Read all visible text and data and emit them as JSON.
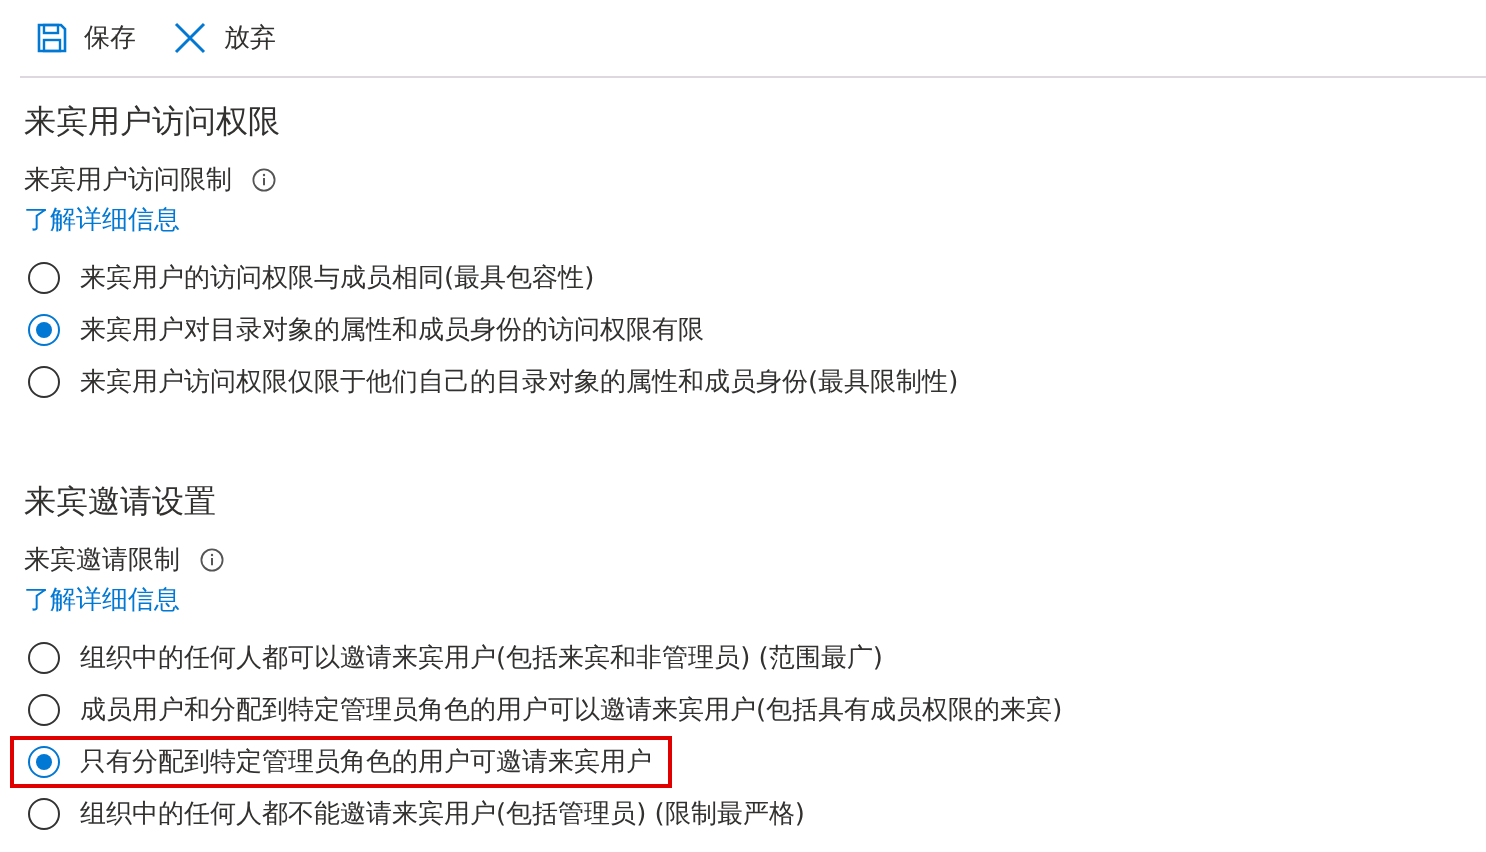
{
  "toolbar": {
    "buttons": [
      {
        "kind": "save",
        "label": "保存"
      },
      {
        "kind": "discard",
        "label": "放弃"
      }
    ]
  },
  "sections": [
    {
      "title": "来宾用户访问权限",
      "field_label": "来宾用户访问限制",
      "link": "了解详细信息",
      "options": [
        {
          "label": "来宾用户的访问权限与成员相同(最具包容性)",
          "selected": false,
          "highlighted": false
        },
        {
          "label": "来宾用户对目录对象的属性和成员身份的访问权限有限",
          "selected": true,
          "highlighted": false
        },
        {
          "label": "来宾用户访问权限仅限于他们自己的目录对象的属性和成员身份(最具限制性)",
          "selected": false,
          "highlighted": false
        }
      ]
    },
    {
      "title": "来宾邀请设置",
      "field_label": "来宾邀请限制",
      "link": "了解详细信息",
      "options": [
        {
          "label": "组织中的任何人都可以邀请来宾用户(包括来宾和非管理员) (范围最广)",
          "selected": false,
          "highlighted": false
        },
        {
          "label": "成员用户和分配到特定管理员角色的用户可以邀请来宾用户(包括具有成员权限的来宾)",
          "selected": false,
          "highlighted": false
        },
        {
          "label": "只有分配到特定管理员角色的用户可邀请来宾用户",
          "selected": true,
          "highlighted": true
        },
        {
          "label": "组织中的任何人都不能邀请来宾用户(包括管理员) (限制最严格)",
          "selected": false,
          "highlighted": false
        }
      ]
    }
  ]
}
